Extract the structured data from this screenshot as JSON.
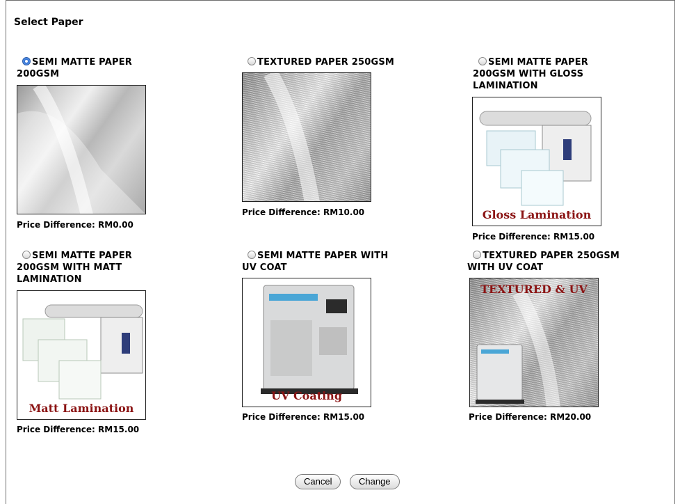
{
  "page": {
    "title": "Select Paper"
  },
  "options": [
    {
      "line1": "SEMI MATTE PAPER",
      "line2": "200GSM",
      "line3": "",
      "price": "Price Difference: RM0.00",
      "checked": true,
      "caption": ""
    },
    {
      "line1": "TEXTURED PAPER 250GSM",
      "line2": "",
      "line3": "",
      "price": "Price Difference: RM10.00",
      "checked": false,
      "caption": ""
    },
    {
      "line1": "SEMI MATTE PAPER",
      "line2": "200GSM WITH GLOSS",
      "line3": "LAMINATION",
      "price": "Price Difference: RM15.00",
      "checked": false,
      "caption": "Gloss Lamination"
    },
    {
      "line1": "SEMI MATTE PAPER",
      "line2": "200GSM WITH MATT",
      "line3": "LAMINATION",
      "price": "Price Difference: RM15.00",
      "checked": false,
      "caption": "Matt Lamination"
    },
    {
      "line1": "SEMI MATTE PAPER WITH",
      "line2": "UV COAT",
      "line3": "",
      "price": "Price Difference: RM15.00",
      "checked": false,
      "caption": "UV Coating"
    },
    {
      "line1": "TEXTURED PAPER 250GSM",
      "line2": "WITH UV COAT",
      "line3": "",
      "price": "Price Difference: RM20.00",
      "checked": false,
      "caption": "TEXTURED & UV"
    }
  ],
  "buttons": {
    "cancel": "Cancel",
    "change": "Change"
  }
}
